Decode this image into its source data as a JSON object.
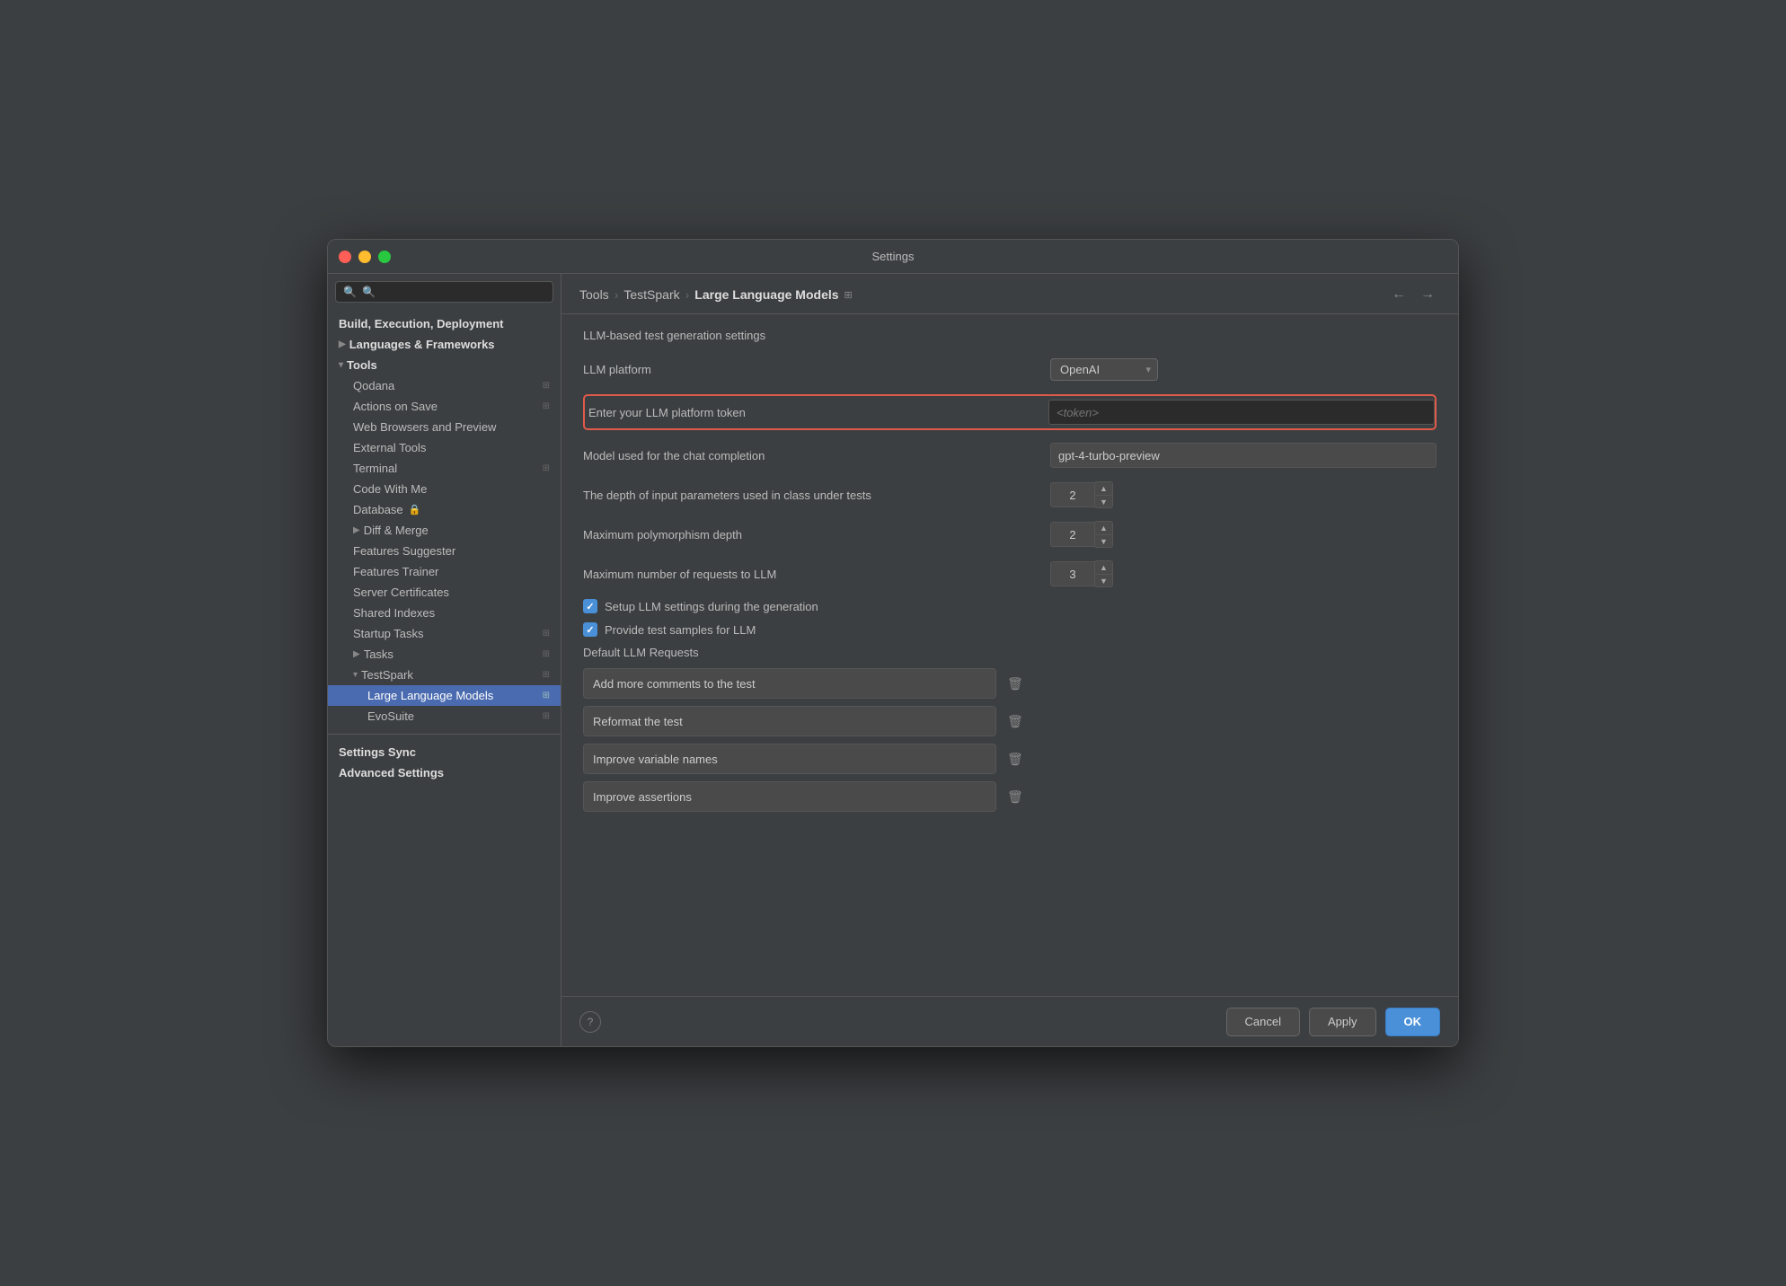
{
  "window": {
    "title": "Settings"
  },
  "sidebar": {
    "search_placeholder": "🔍",
    "items": [
      {
        "id": "build-execution",
        "label": "Build, Execution, Deployment",
        "bold": true,
        "indent": 0
      },
      {
        "id": "languages-frameworks",
        "label": "Languages & Frameworks",
        "bold": true,
        "indent": 0,
        "arrow": "▶"
      },
      {
        "id": "tools",
        "label": "Tools",
        "bold": true,
        "indent": 0,
        "arrow": "▾",
        "expanded": true
      },
      {
        "id": "qodana",
        "label": "Qodana",
        "indent": 1,
        "pin": true
      },
      {
        "id": "actions-on-save",
        "label": "Actions on Save",
        "indent": 1,
        "pin": true
      },
      {
        "id": "web-browsers",
        "label": "Web Browsers and Preview",
        "indent": 1
      },
      {
        "id": "external-tools",
        "label": "External Tools",
        "indent": 1
      },
      {
        "id": "terminal",
        "label": "Terminal",
        "indent": 1,
        "pin": true
      },
      {
        "id": "code-with-me",
        "label": "Code With Me",
        "indent": 1
      },
      {
        "id": "database",
        "label": "Database",
        "indent": 1,
        "lock": true
      },
      {
        "id": "diff-merge",
        "label": "Diff & Merge",
        "indent": 1,
        "arrow": "▶"
      },
      {
        "id": "features-suggester",
        "label": "Features Suggester",
        "indent": 1
      },
      {
        "id": "features-trainer",
        "label": "Features Trainer",
        "indent": 1
      },
      {
        "id": "server-certificates",
        "label": "Server Certificates",
        "indent": 1
      },
      {
        "id": "shared-indexes",
        "label": "Shared Indexes",
        "indent": 1
      },
      {
        "id": "startup-tasks",
        "label": "Startup Tasks",
        "indent": 1,
        "pin": true
      },
      {
        "id": "tasks",
        "label": "Tasks",
        "indent": 1,
        "arrow": "▶",
        "pin": true
      },
      {
        "id": "testspark",
        "label": "TestSpark",
        "indent": 1,
        "arrow": "▾",
        "expanded": true,
        "pin": true
      },
      {
        "id": "large-language-models",
        "label": "Large Language Models",
        "indent": 2,
        "pin": true,
        "active": true
      },
      {
        "id": "evosuite",
        "label": "EvoSuite",
        "indent": 2,
        "pin": true
      },
      {
        "id": "settings-sync",
        "label": "Settings Sync",
        "bold": true,
        "indent": 0
      },
      {
        "id": "advanced-settings",
        "label": "Advanced Settings",
        "bold": true,
        "indent": 0
      }
    ]
  },
  "breadcrumb": {
    "items": [
      "Tools",
      "TestSpark",
      "Large Language Models"
    ],
    "pin_label": "⊞"
  },
  "main": {
    "section_label": "LLM-based test generation settings",
    "llm_platform_label": "LLM platform",
    "llm_platform_value": "OpenAI",
    "token_label": "Enter your LLM platform token",
    "token_placeholder": "<token>",
    "model_label": "Model used for the chat completion",
    "model_value": "gpt-4-turbo-preview",
    "depth_label": "The depth of input parameters used in class under tests",
    "depth_value": "2",
    "polymorphism_label": "Maximum polymorphism depth",
    "polymorphism_value": "2",
    "max_requests_label": "Maximum number of requests to LLM",
    "max_requests_value": "3",
    "setup_llm_label": "Setup LLM settings during the generation",
    "setup_llm_checked": true,
    "test_samples_label": "Provide test samples for LLM",
    "test_samples_checked": true,
    "default_requests_title": "Default LLM Requests",
    "requests": [
      {
        "id": "req1",
        "value": "Add more comments to the test"
      },
      {
        "id": "req2",
        "value": "Reformat the test"
      },
      {
        "id": "req3",
        "value": "Improve variable names"
      },
      {
        "id": "req4",
        "value": "Improve assertions"
      }
    ]
  },
  "footer": {
    "cancel_label": "Cancel",
    "apply_label": "Apply",
    "ok_label": "OK",
    "help_label": "?"
  }
}
